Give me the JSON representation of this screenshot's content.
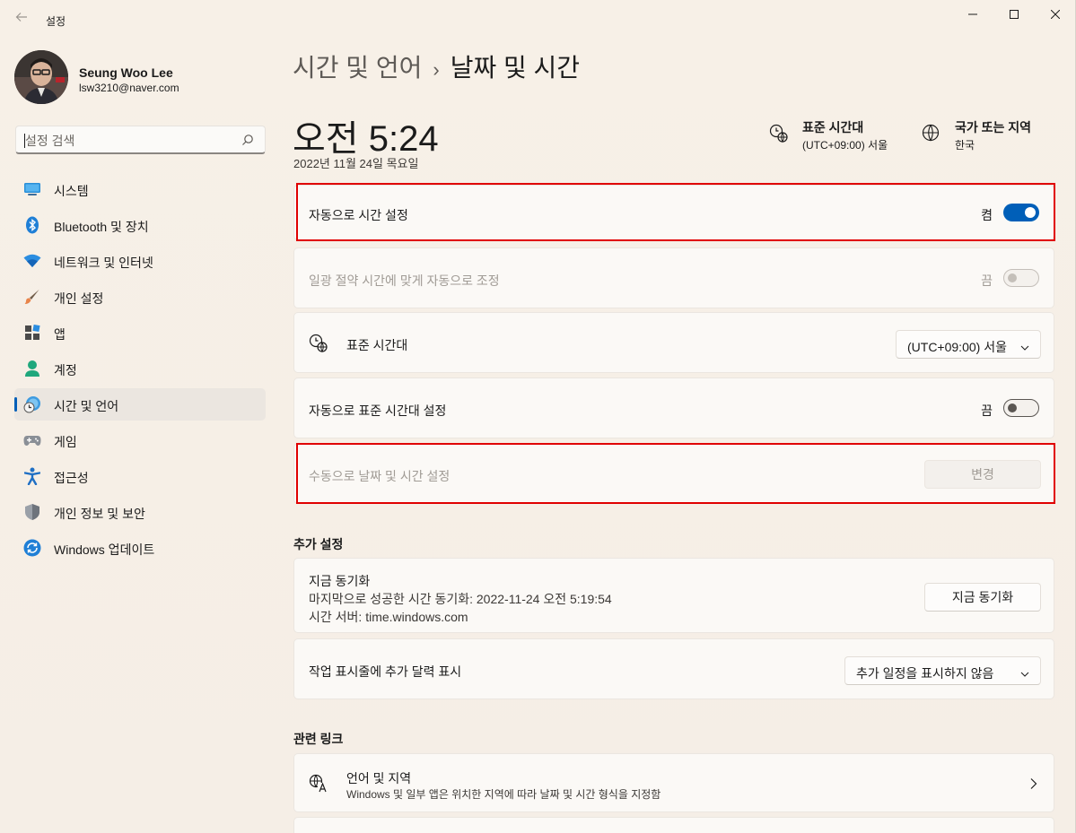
{
  "window": {
    "app_title": "설정"
  },
  "user": {
    "name": "Seung Woo Lee",
    "email": "lsw3210@naver.com"
  },
  "search": {
    "placeholder": "설정 검색"
  },
  "sidebar": {
    "items": [
      {
        "label": "시스템",
        "icon": "system-icon"
      },
      {
        "label": "Bluetooth 및 장치",
        "icon": "bluetooth-icon"
      },
      {
        "label": "네트워크 및 인터넷",
        "icon": "wifi-icon"
      },
      {
        "label": "개인 설정",
        "icon": "brush-icon"
      },
      {
        "label": "앱",
        "icon": "apps-icon"
      },
      {
        "label": "계정",
        "icon": "account-icon"
      },
      {
        "label": "시간 및 언어",
        "icon": "time-language-icon",
        "active": true
      },
      {
        "label": "게임",
        "icon": "gamepad-icon"
      },
      {
        "label": "접근성",
        "icon": "accessibility-icon"
      },
      {
        "label": "개인 정보 및 보안",
        "icon": "shield-icon"
      },
      {
        "label": "Windows 업데이트",
        "icon": "update-icon"
      }
    ]
  },
  "header": {
    "parent": "시간 및 언어",
    "separator": "›",
    "current": "날짜 및 시간",
    "time": "오전 5:24",
    "date": "2022년 11월 24일 목요일",
    "timezone_title": "표준 시간대",
    "timezone_value": "(UTC+09:00) 서울",
    "region_title": "국가 또는 지역",
    "region_value": "한국"
  },
  "settings": {
    "auto_time": {
      "label": "자동으로 시간 설정",
      "state": "켬",
      "on": true
    },
    "dst": {
      "label": "일광 절약 시간에 맞게 자동으로 조정",
      "state": "끔",
      "on": false
    },
    "timezone": {
      "label": "표준 시간대",
      "value": "(UTC+09:00) 서울"
    },
    "auto_timezone": {
      "label": "자동으로 표준 시간대 설정",
      "state": "끔",
      "on": false
    },
    "manual": {
      "label": "수동으로 날짜 및 시간 설정",
      "button": "변경"
    }
  },
  "additional": {
    "title": "추가 설정",
    "sync": {
      "title": "지금 동기화",
      "last_sync": "마지막으로 성공한 시간 동기화: 2022-11-24 오전 5:19:54",
      "server": "시간 서버: time.windows.com",
      "button": "지금 동기화"
    },
    "calendar": {
      "label": "작업 표시줄에 추가 달력 표시",
      "value": "추가 일정을 표시하지 않음"
    }
  },
  "related": {
    "title": "관련 링크",
    "language_region": {
      "title": "언어 및 지역",
      "subtitle": "Windows 및 일부 앱은 위치한 지역에 따라 날짜 및 시간 형식을 지정함"
    }
  },
  "colors": {
    "accent": "#005fb8",
    "highlight_border": "#e00000",
    "background": "#f6efe6"
  }
}
